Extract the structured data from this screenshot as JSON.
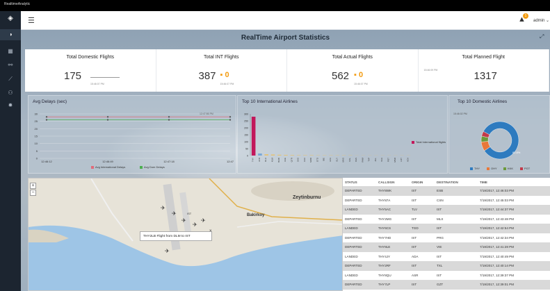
{
  "app": {
    "brand": "RealtimeAnalytic"
  },
  "topbar": {
    "menu_icon": "hamburger-icon",
    "alert_count": "1",
    "user": "admin ⌄"
  },
  "sidebar": {
    "items": [
      "dashboard-icon",
      "analytics-icon",
      "link-icon",
      "chart-icon",
      "users-icon",
      "gear-icon"
    ]
  },
  "page": {
    "title": "RealTime Airport Statistics"
  },
  "stats": [
    {
      "label": "Total Domestic Flights",
      "value": "175",
      "time": "15:46:07 PM"
    },
    {
      "label": "Total INT Flights",
      "value": "387",
      "delta": "0",
      "time": "15:46:07 PM"
    },
    {
      "label": "Total Actual Flights",
      "value": "562",
      "delta": "0",
      "time": "15:46:07 PM"
    },
    {
      "label": "Total Planned Flight",
      "value": "1317",
      "time": "15:46:09 PM"
    }
  ],
  "panels": {
    "delays": {
      "title": "Avg Delays (sec)",
      "corner_time": "12:47:56 PM",
      "xticks": [
        "12:46:12",
        "12:46:49",
        "12:47:18",
        "12:47"
      ],
      "legend": [
        "Avg International Delays",
        "Avg Dom Delays"
      ]
    },
    "intl": {
      "title": "Top 10 International Airlines",
      "legend": "Total International flights"
    },
    "dom": {
      "title": "Top 10 Domestic Airlines",
      "corner_time": "15:46:02 PM",
      "slice_label": "82.8%",
      "legend": [
        "THY",
        "OHY",
        "KKK",
        "PGT"
      ]
    }
  },
  "chart_data": [
    {
      "type": "line",
      "title": "Avg Delays (sec)",
      "x": [
        "12:46:12",
        "12:46:49",
        "12:47:18",
        "12:47"
      ],
      "series": [
        {
          "name": "Avg International Delays",
          "values": [
            28,
            28,
            28,
            28
          ]
        },
        {
          "name": "Avg Dom Delays",
          "values": [
            26,
            26,
            26,
            26
          ]
        }
      ],
      "ylim": [
        0,
        30
      ],
      "yticks": [
        "0",
        "5",
        "10",
        "15",
        "20",
        "25",
        "30"
      ]
    },
    {
      "type": "bar",
      "title": "Top 10 International Airlines",
      "categories": [
        "THY",
        "AFR",
        "DLH",
        "KLM",
        "BAW",
        "UAE",
        "QTR",
        "SAS",
        "AUA",
        "SWR",
        "ETD",
        "IBE",
        "AZA",
        "ELY",
        "MAS",
        "KAL",
        "CES",
        "RAM",
        "TAP",
        "AFL",
        "SVA",
        "PGT",
        "MSR",
        "LOT",
        "ACA"
      ],
      "series": [
        {
          "name": "Total International flights",
          "values": [
            280,
            15,
            10,
            8,
            6,
            5,
            4,
            3,
            3,
            3,
            2,
            2,
            2,
            2,
            2,
            2,
            1,
            1,
            1,
            1,
            1,
            1,
            1,
            1,
            1
          ]
        }
      ],
      "ylim": [
        0,
        300
      ],
      "yticks": [
        "0",
        "50",
        "100",
        "150",
        "200",
        "250",
        "300"
      ]
    },
    {
      "type": "pie",
      "title": "Top 10 Domestic Airlines",
      "categories": [
        "THY",
        "OHY",
        "KKK",
        "PGT"
      ],
      "values": [
        82.8,
        8,
        5,
        4.2
      ],
      "colors": [
        "#2e7bbf",
        "#e8783a",
        "#6c9a3b",
        "#c23a4a"
      ]
    }
  ],
  "map": {
    "labels": [
      "Zeytinburnu",
      "Bakirkoy",
      "IST"
    ],
    "popup": "THY2LB Flight from DLM to IST"
  },
  "table": {
    "headers": [
      "STATUS",
      "CALLSIGN",
      "ORIGIN",
      "DESTINATION",
      "TIME"
    ],
    "rows": [
      [
        "DEPARTED",
        "THY8WK",
        "IST",
        "ESB",
        "7/19/2017, 12:46:03 PM"
      ],
      [
        "DEPARTED",
        "THY87A",
        "IST",
        "CSN",
        "7/19/2017, 12:45:03 PM"
      ],
      [
        "LANDED",
        "THY5AC",
        "TLV",
        "IST",
        "7/19/2017, 12:44:37 PM"
      ],
      [
        "DEPARTED",
        "THY2MG",
        "IST",
        "MLX",
        "7/19/2017, 12:43:48 PM"
      ],
      [
        "LANDED",
        "THY6CS",
        "TGD",
        "IST",
        "7/19/2017, 12:42:54 PM"
      ],
      [
        "DEPARTED",
        "THY7HD",
        "IST",
        "PRG",
        "7/19/2017, 12:42:34 PM"
      ],
      [
        "DEPARTED",
        "THY8LE",
        "IST",
        "VIE",
        "7/19/2017, 12:41:28 PM"
      ],
      [
        "LANDED",
        "THY4JY",
        "ADA",
        "IST",
        "7/19/2017, 12:40:49 PM"
      ],
      [
        "DEPARTED",
        "THY2RF",
        "IST",
        "TXL",
        "7/19/2017, 12:40:14 PM"
      ],
      [
        "LANDED",
        "THY8QU",
        "ASR",
        "IST",
        "7/19/2017, 12:39:37 PM"
      ],
      [
        "DEPARTED",
        "THY7LP",
        "IST",
        "GZT",
        "7/19/2017, 12:39:01 PM"
      ]
    ]
  }
}
